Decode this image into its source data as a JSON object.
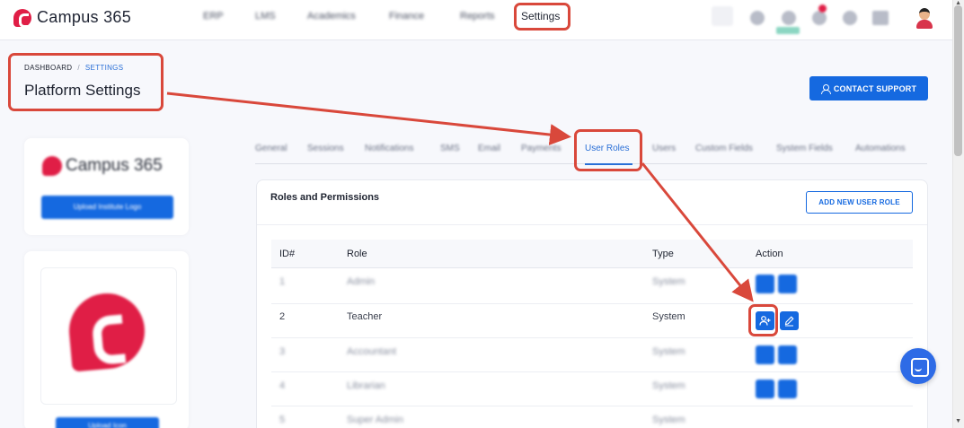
{
  "app": {
    "name": "Campus 365"
  },
  "topnav": {
    "items": [
      "ERP",
      "LMS",
      "Academics",
      "Finance",
      "Reports"
    ],
    "active": "Settings"
  },
  "header": {
    "breadcrumb_root": "DASHBOARD",
    "breadcrumb_current": "SETTINGS",
    "title": "Platform Settings",
    "contact_label": "CONTACT SUPPORT"
  },
  "sidebar": {
    "logo_text": "Campus 365",
    "upload_logo_label": "Upload Institute Logo",
    "upload_icon_label": "Upload Icon"
  },
  "tabs": {
    "items": [
      "General",
      "Sessions",
      "Notifications",
      "SMS",
      "Email",
      "Payments",
      "User Roles",
      "Users",
      "Custom Fields",
      "System Fields",
      "Automations"
    ],
    "active": "User Roles"
  },
  "roles": {
    "title": "Roles and Permissions",
    "add_label": "ADD NEW USER ROLE",
    "columns": [
      "ID#",
      "Role",
      "Type",
      "Action"
    ],
    "rows": [
      {
        "id": "1",
        "role": "Admin",
        "type": "System"
      },
      {
        "id": "2",
        "role": "Teacher",
        "type": "System"
      },
      {
        "id": "3",
        "role": "Accountant",
        "type": "System"
      },
      {
        "id": "4",
        "role": "Librarian",
        "type": "System"
      },
      {
        "id": "5",
        "role": "Super Admin",
        "type": "System"
      }
    ]
  },
  "colors": {
    "primary": "#1569e0",
    "brand": "#e01e46",
    "annotation": "#d9483b"
  },
  "icons": [
    "search-icon",
    "bell-icon",
    "user-icon",
    "user-plus-icon",
    "edit-icon",
    "chat-icon"
  ]
}
